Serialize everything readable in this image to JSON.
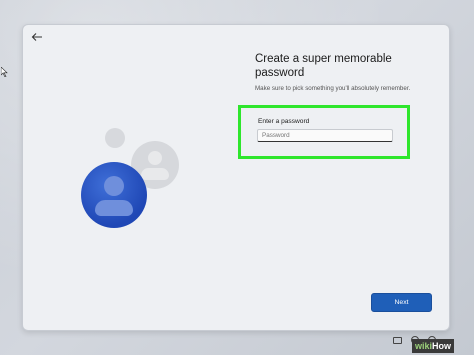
{
  "dialog": {
    "title": "Create a super memorable password",
    "subtitle": "Make sure to pick something you'll absolutely remember.",
    "field_label": "Enter a password",
    "password_placeholder": "Password",
    "next_label": "Next"
  },
  "watermark": {
    "part1": "wiki",
    "part2": "How"
  },
  "colors": {
    "accent": "#1f5fb8",
    "highlight": "#2ee62c",
    "avatar": "#2a55c4"
  },
  "icons": [
    "back-arrow-icon",
    "cursor-icon",
    "keyboard-icon",
    "accessibility-icon",
    "power-icon"
  ]
}
